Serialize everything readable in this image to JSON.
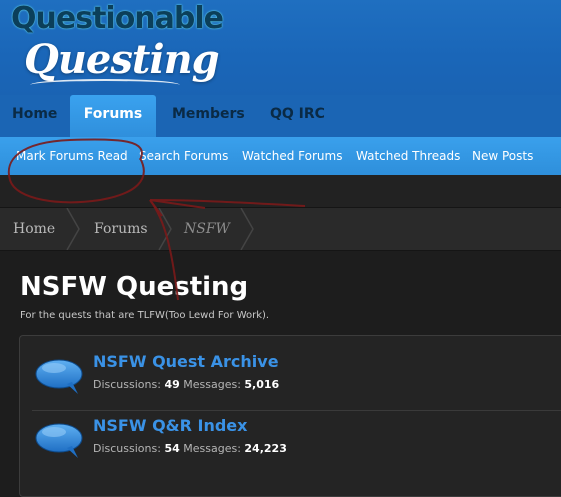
{
  "logo": {
    "line1": "Questionable",
    "line2": "Questing"
  },
  "main_nav": {
    "tabs": [
      {
        "label": "Home"
      },
      {
        "label": "Forums"
      },
      {
        "label": "Members"
      },
      {
        "label": "QQ IRC"
      }
    ],
    "active_tab": "Forums"
  },
  "sub_nav": {
    "links": [
      {
        "label": "Mark Forums Read"
      },
      {
        "label": "Search Forums"
      },
      {
        "label": "Watched Forums"
      },
      {
        "label": "Watched Threads"
      },
      {
        "label": "New Posts"
      }
    ]
  },
  "breadcrumb": {
    "items": [
      {
        "label": "Home"
      },
      {
        "label": "Forums"
      },
      {
        "label": "NSFW"
      }
    ]
  },
  "page": {
    "title": "NSFW Questing",
    "description": "For the quests that are TLFW(Too Lewd For Work)."
  },
  "forums": [
    {
      "title": "NSFW Quest Archive",
      "discussions_label": "Discussions:",
      "discussions": "49",
      "messages_label": "Messages:",
      "messages": "5,016"
    },
    {
      "title": "NSFW Q&R Index",
      "discussions_label": "Discussions:",
      "discussions": "54",
      "messages_label": "Messages:",
      "messages": "24,223"
    }
  ],
  "colors": {
    "header_blue": "#1a66b8",
    "subnav_blue": "#3399e6",
    "link_blue": "#3a92e6",
    "annotation_red": "#7a1a1a"
  }
}
